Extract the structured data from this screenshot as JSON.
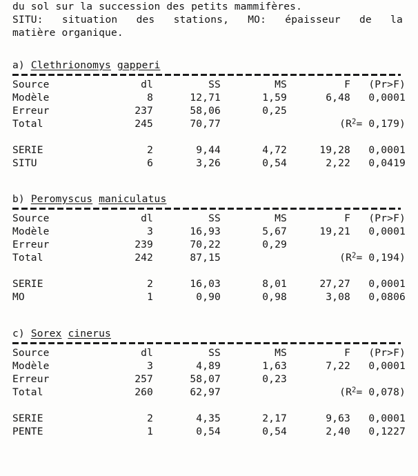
{
  "intro": {
    "lines": [
      "du sol sur la succession des petits mammifères.",
      "SITU: situation des stations, MO: épaisseur de la",
      "matière organique."
    ],
    "line2_words": [
      "SITU:",
      "situation",
      "des",
      "stations,",
      "MO:",
      "épaisseur",
      "de",
      "la"
    ]
  },
  "columns": {
    "source": "Source",
    "dl": "dl",
    "ss": "SS",
    "ms": "MS",
    "f": "F",
    "pr": "(Pr>F)"
  },
  "sections": [
    {
      "id": "a",
      "marker": "a)",
      "genus": "Clethrionomys",
      "species": "gapperi",
      "rows": [
        {
          "source": "Modèle",
          "dl": "8",
          "ss": "12,71",
          "ms": "1,59",
          "f": "6,48",
          "pr": "0,0001"
        },
        {
          "source": "Erreur",
          "dl": "237",
          "ss": "58,06",
          "ms": "0,25",
          "f": "",
          "pr": ""
        },
        {
          "source": "Total",
          "dl": "245",
          "ss": "70,77",
          "ms": "",
          "f": "",
          "pr": ""
        }
      ],
      "r2_prefix": "(R",
      "r2_sup": "2",
      "r2_suffix": "= 0,179)",
      "effects": [
        {
          "source": "SERIE",
          "dl": "2",
          "ss": "9,44",
          "ms": "4,72",
          "f": "19,28",
          "pr": "0,0001"
        },
        {
          "source": "SITU",
          "dl": "6",
          "ss": "3,26",
          "ms": "0,54",
          "f": "2,22",
          "pr": "0,0419"
        }
      ]
    },
    {
      "id": "b",
      "marker": "b)",
      "genus": "Peromyscus",
      "species": "maniculatus",
      "rows": [
        {
          "source": "Modèle",
          "dl": "3",
          "ss": "16,93",
          "ms": "5,67",
          "f": "19,21",
          "pr": "0,0001"
        },
        {
          "source": "Erreur",
          "dl": "239",
          "ss": "70,22",
          "ms": "0,29",
          "f": "",
          "pr": ""
        },
        {
          "source": "Total",
          "dl": "242",
          "ss": "87,15",
          "ms": "",
          "f": "",
          "pr": ""
        }
      ],
      "r2_prefix": "(R",
      "r2_sup": "2",
      "r2_suffix": "= 0,194)",
      "effects": [
        {
          "source": "SERIE",
          "dl": "2",
          "ss": "16,03",
          "ms": "8,01",
          "f": "27,27",
          "pr": "0,0001"
        },
        {
          "source": "MO",
          "dl": "1",
          "ss": "0,90",
          "ms": "0,98",
          "f": "3,08",
          "pr": "0,0806"
        }
      ]
    },
    {
      "id": "c",
      "marker": "c)",
      "genus": "Sorex",
      "species": "cinerus",
      "rows": [
        {
          "source": "Modèle",
          "dl": "3",
          "ss": "4,89",
          "ms": "1,63",
          "f": "7,22",
          "pr": "0,0001"
        },
        {
          "source": "Erreur",
          "dl": "257",
          "ss": "58,07",
          "ms": "0,23",
          "f": "",
          "pr": ""
        },
        {
          "source": "Total",
          "dl": "260",
          "ss": "62,97",
          "ms": "",
          "f": "",
          "pr": ""
        }
      ],
      "r2_prefix": "(R",
      "r2_sup": "2",
      "r2_suffix": "= 0,078)",
      "effects": [
        {
          "source": "SERIE",
          "dl": "2",
          "ss": "4,35",
          "ms": "2,17",
          "f": "9,63",
          "pr": "0,0001"
        },
        {
          "source": "PENTE",
          "dl": "1",
          "ss": "0,54",
          "ms": "0,54",
          "f": "2,40",
          "pr": "0,1227"
        }
      ]
    }
  ]
}
